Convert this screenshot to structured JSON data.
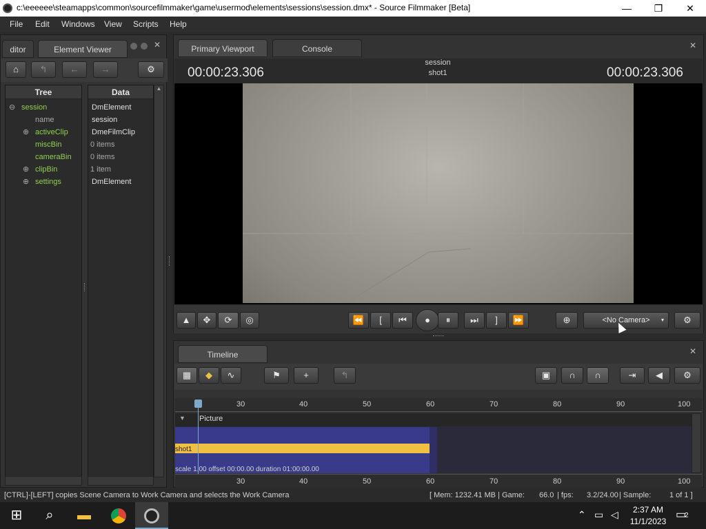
{
  "window": {
    "title": "c:\\eeeeee\\steamapps\\common\\sourcefilmmaker\\game\\usermod\\elements\\sessions\\session.dmx* - Source Filmmaker [Beta]",
    "minimize_glyph": "—",
    "maximize_glyph": "❐",
    "close_glyph": "✕"
  },
  "menu": [
    "File",
    "Edit",
    "Windows",
    "View",
    "Scripts",
    "Help"
  ],
  "left_panel": {
    "tabs": [
      "ditor",
      "Element Viewer"
    ],
    "tree_header": "Tree",
    "data_header": "Data",
    "tree": [
      {
        "expander": "⊖",
        "label": "session",
        "value": "DmElement",
        "color": "green"
      },
      {
        "expander": "",
        "label": "name",
        "value": "session",
        "color": "grey"
      },
      {
        "expander": "⊕",
        "label": "activeClip",
        "value": "DmeFilmClip",
        "color": "green"
      },
      {
        "expander": "",
        "label": "miscBin",
        "value": "0 items",
        "color": "green"
      },
      {
        "expander": "",
        "label": "cameraBin",
        "value": "0 items",
        "color": "green"
      },
      {
        "expander": "⊕",
        "label": "clipBin",
        "value": "1 item",
        "color": "green"
      },
      {
        "expander": "⊕",
        "label": "settings",
        "value": "DmElement",
        "color": "green"
      }
    ]
  },
  "viewport": {
    "tabs": [
      "Primary Viewport",
      "Console"
    ],
    "timecode_left": "00:00:23.306",
    "timecode_right": "00:00:23.306",
    "session_label": "session",
    "shot_label": "shot1",
    "camera_select": "<No Camera>"
  },
  "timeline": {
    "tab": "Timeline",
    "ruler_ticks": [
      "30",
      "40",
      "50",
      "60",
      "70",
      "80",
      "90",
      "100"
    ],
    "track_label": "Picture",
    "clip_name": "shot1",
    "clip_info": "scale 1.00 offset  00:00.00 duration  01:00:00.00"
  },
  "status": {
    "hint": "[CTRL]-[LEFT] copies Scene Camera to Work Camera and selects the Work Camera",
    "mem": "[ Mem:  1232.41 MB | Game:",
    "game": "66.0",
    "fps_label": "| fps:",
    "fps": "3.2/24.00",
    "sample_label": "| Sample:",
    "sample": "1 of 1 ]"
  },
  "taskbar": {
    "time": "2:37 AM",
    "date": "11/1/2023",
    "notification_count": "2"
  },
  "colors": {
    "accent_yellow": "#f0c040",
    "clip_blue": "#3a3a8a",
    "tree_green": "#8fd14f"
  }
}
